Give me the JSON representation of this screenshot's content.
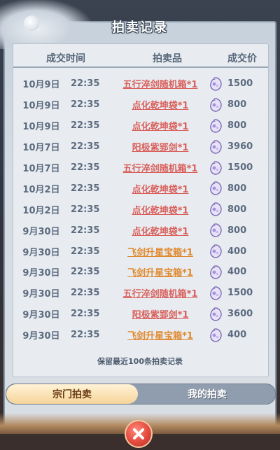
{
  "title": "拍卖记录",
  "header": {
    "time": "成交时间",
    "item": "拍卖品",
    "price": "成交价"
  },
  "colors": {
    "item_red": "#d9605c",
    "item_orange": "#e0892f",
    "text_gray": "#5c6b80"
  },
  "records": [
    {
      "date": "10月9日",
      "time": "22:35",
      "item": "五行淬剑随机箱*1",
      "tone": "red",
      "price": "1500"
    },
    {
      "date": "10月9日",
      "time": "22:35",
      "item": "点化乾坤袋*1",
      "tone": "red",
      "price": "800"
    },
    {
      "date": "10月9日",
      "time": "22:35",
      "item": "点化乾坤袋*1",
      "tone": "red",
      "price": "800"
    },
    {
      "date": "10月7日",
      "time": "22:35",
      "item": "阳极紫郢剑*1",
      "tone": "red",
      "price": "3960"
    },
    {
      "date": "10月7日",
      "time": "22:35",
      "item": "五行淬剑随机箱*1",
      "tone": "red",
      "price": "1500"
    },
    {
      "date": "10月2日",
      "time": "22:35",
      "item": "点化乾坤袋*1",
      "tone": "red",
      "price": "800"
    },
    {
      "date": "10月2日",
      "time": "22:35",
      "item": "点化乾坤袋*1",
      "tone": "red",
      "price": "800"
    },
    {
      "date": "9月30日",
      "time": "22:35",
      "item": "点化乾坤袋*1",
      "tone": "red",
      "price": "800"
    },
    {
      "date": "9月30日",
      "time": "22:35",
      "item": "飞剑升星宝箱*1",
      "tone": "orange",
      "price": "400"
    },
    {
      "date": "9月30日",
      "time": "22:35",
      "item": "飞剑升星宝箱*1",
      "tone": "orange",
      "price": "400"
    },
    {
      "date": "9月30日",
      "time": "22:35",
      "item": "五行淬剑随机箱*1",
      "tone": "red",
      "price": "1500"
    },
    {
      "date": "9月30日",
      "time": "22:35",
      "item": "阳极紫郢剑*1",
      "tone": "red",
      "price": "3600"
    },
    {
      "date": "9月30日",
      "time": "22:35",
      "item": "飞剑升星宝箱*1",
      "tone": "orange",
      "price": "400"
    }
  ],
  "footer_note": "保留最近100条拍卖记录",
  "tabs": {
    "sect": "宗门拍卖",
    "mine": "我的拍卖"
  },
  "icons": {
    "price": "spirit-coin-icon",
    "close": "close-icon"
  }
}
